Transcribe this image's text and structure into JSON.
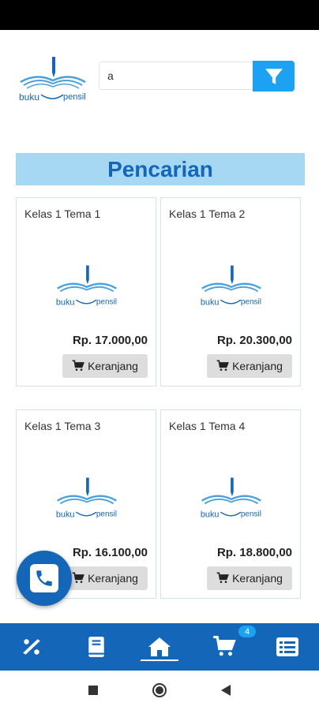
{
  "search": {
    "value": "a"
  },
  "section": {
    "title": "Pencarian"
  },
  "brand": {
    "word1": "buku",
    "word2": "pensil"
  },
  "products": [
    {
      "name": "Kelas 1 Tema 1",
      "price": "Rp. 17.000,00",
      "cart_label": "Keranjang"
    },
    {
      "name": "Kelas 1 Tema 2",
      "price": "Rp. 20.300,00",
      "cart_label": "Keranjang"
    },
    {
      "name": "Kelas 1 Tema 3",
      "price": "Rp. 16.100,00",
      "cart_label": "Keranjang"
    },
    {
      "name": "Kelas 1 Tema 4",
      "price": "Rp. 18.800,00",
      "cart_label": "Keranjang"
    }
  ],
  "nav": {
    "items": [
      {
        "icon": "percent-icon"
      },
      {
        "icon": "book-icon"
      },
      {
        "icon": "home-icon",
        "active": true
      },
      {
        "icon": "cart-icon"
      },
      {
        "icon": "list-icon"
      }
    ],
    "cart_badge": "4"
  },
  "colors": {
    "primary": "#1466b8",
    "accent": "#1da1f2",
    "title_bg": "#a7d8f3"
  }
}
